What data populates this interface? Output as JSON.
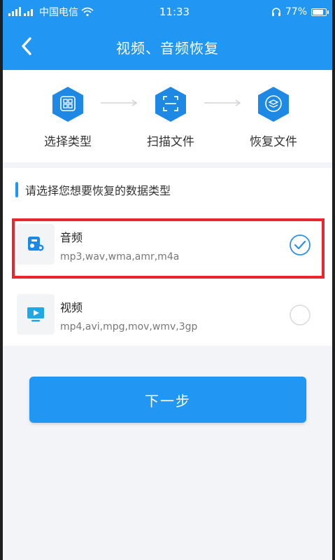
{
  "status_bar": {
    "carrier": "中国电信",
    "time": "11:33",
    "battery": "77%",
    "battery_level": 0.77
  },
  "header": {
    "title": "视频、音频恢复"
  },
  "steps": [
    {
      "label": "选择类型",
      "icon": "grid-icon"
    },
    {
      "label": "扫描文件",
      "icon": "scan-icon"
    },
    {
      "label": "恢复文件",
      "icon": "layers-icon"
    }
  ],
  "section": {
    "title": "请选择您想要恢复的数据类型"
  },
  "items": [
    {
      "name": "音频",
      "formats": "mp3,wav,wma,amr,m4a",
      "selected": true,
      "icon": "audio-icon"
    },
    {
      "name": "视频",
      "formats": "mp4,avi,mpg,mov,wmv,3gp",
      "selected": false,
      "icon": "video-icon"
    }
  ],
  "actions": {
    "next_label": "下一步"
  },
  "colors": {
    "primary": "#2196f3",
    "highlight": "#e8262d",
    "hex_icon": "#1e88e5"
  }
}
